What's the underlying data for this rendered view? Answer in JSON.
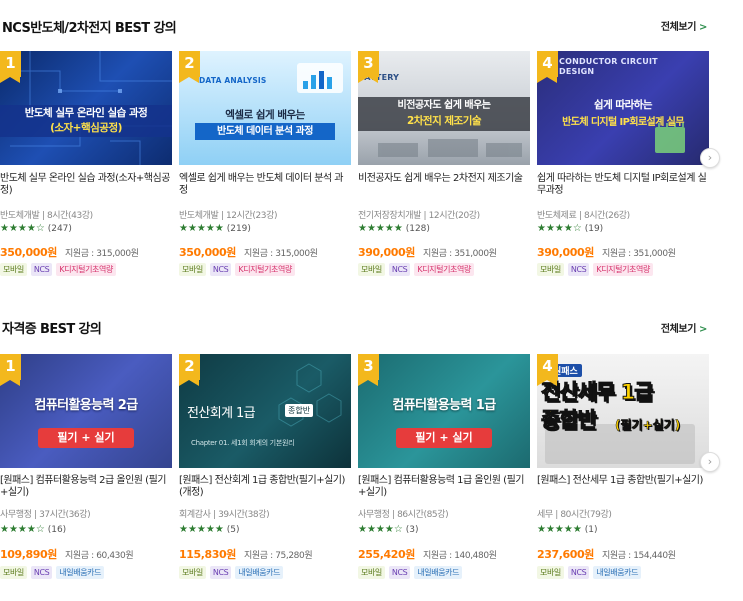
{
  "sections": [
    {
      "title": "NCS반도체/2차전지 BEST 강의",
      "see_all": "전체보기",
      "cards": [
        {
          "rank": "1",
          "thumb_line1": "반도체 실무 온라인 실습 과정",
          "thumb_line2": "(소자+핵심공정)",
          "title": "반도체 실무 온라인 실습 과정(소자+핵심공정)",
          "meta": "반도체개발 | 8시간(43강)",
          "stars": "★★★★☆",
          "reviews": "(247)",
          "price": "350,000원",
          "subsidy": "지원금 : 315,000원",
          "tags": [
            "모바일",
            "NCS",
            "K디지털기초역량"
          ]
        },
        {
          "rank": "2",
          "thumb_tag": "DATA ANALYSIS",
          "thumb_line1": "엑셀로 쉽게 배우는",
          "thumb_line2": "반도체 데이터 분석 과정",
          "title": "엑셀로 쉽게 배우는 반도체 데이터 분석 과정",
          "meta": "반도체개발 | 12시간(23강)",
          "stars": "★★★★★",
          "reviews": "(219)",
          "price": "350,000원",
          "subsidy": "지원금 : 315,000원",
          "tags": [
            "모바일",
            "NCS",
            "K디지털기초역량"
          ]
        },
        {
          "rank": "3",
          "thumb_tag": "BATTERY",
          "thumb_line1": "비전공자도 쉽게 배우는",
          "thumb_line2": "2차전지 제조기술",
          "title": "비전공자도 쉽게 배우는 2차전지 제조기술",
          "meta": "전기저장장치개발 | 12시간(20강)",
          "stars": "★★★★★",
          "reviews": "(128)",
          "price": "390,000원",
          "subsidy": "지원금 : 351,000원",
          "tags": [
            "모바일",
            "NCS",
            "K디지털기초역량"
          ]
        },
        {
          "rank": "4",
          "thumb_tag": "CONDUCTOR CIRCUIT DESIGN",
          "thumb_line1": "쉽게 따라하는",
          "thumb_line2": "반도체 디지털 IP회로설계 실무",
          "title": "쉽게 따라하는 반도체 디지털 IP회로설계 실무과정",
          "meta": "반도체제료 | 8시간(26강)",
          "stars": "★★★★☆",
          "reviews": "(19)",
          "price": "390,000원",
          "subsidy": "지원금 : 351,000원",
          "tags": [
            "모바일",
            "NCS",
            "K디지털기초역량"
          ]
        }
      ]
    },
    {
      "title": "자격증 BEST 강의",
      "see_all": "전체보기",
      "cards": [
        {
          "rank": "1",
          "thumb_line1": "컴퓨터활용능력 2급",
          "thumb_line2": "필기 + 실기",
          "title": "[원패스] 컴퓨터활용능력 2급 올인원 (필기+실기)",
          "meta": "사무행정 | 37시간(36강)",
          "stars": "★★★★☆",
          "reviews": "(16)",
          "price": "109,890원",
          "subsidy": "지원금 : 60,430원",
          "tags": [
            "모바일",
            "NCS",
            "내일배움카드"
          ]
        },
        {
          "rank": "2",
          "thumb_line1": "전산회계 1급",
          "thumb_badge": "종합반",
          "thumb_line2": "Chapter 01. 세1회 회계의 기본원리",
          "title": "[원패스] 전산회계 1급 종합반(필기+실기) (개정)",
          "meta": "회계감사 | 39시간(38강)",
          "stars": "★★★★★",
          "reviews": "(5)",
          "price": "115,830원",
          "subsidy": "지원금 : 75,280원",
          "tags": [
            "모바일",
            "NCS",
            "내일배움카드"
          ]
        },
        {
          "rank": "3",
          "thumb_line1": "컴퓨터활용능력 1급",
          "thumb_line2": "필기 + 실기",
          "title": "[원패스] 컴퓨터활용능력 1급 올인원 (필기+실기)",
          "meta": "사무행정 | 86시간(85강)",
          "stars": "★★★★☆",
          "reviews": "(3)",
          "price": "255,420원",
          "subsidy": "지원금 : 140,480원",
          "tags": [
            "모바일",
            "NCS",
            "내일배움카드"
          ]
        },
        {
          "rank": "4",
          "thumb_tag": "원패스",
          "thumb_line1": "전산세무 1급",
          "thumb_line2": "종합반",
          "thumb_line3": "(필기+실기)",
          "title": "[원패스] 전산세무 1급 종합반(필기+실기)",
          "meta": "세무 | 80시간(79강)",
          "stars": "★★★★★",
          "reviews": "(1)",
          "price": "237,600원",
          "subsidy": "지원금 : 154,440원",
          "tags": [
            "모바일",
            "NCS",
            "내일배움카드"
          ]
        }
      ]
    }
  ],
  "ui": {
    "next_arrow": "›",
    "see_all_chevron": ">"
  },
  "colors": {
    "price": "#ff7a00",
    "stars": "#2e7d32",
    "rank_badge": "#f3b81d"
  }
}
